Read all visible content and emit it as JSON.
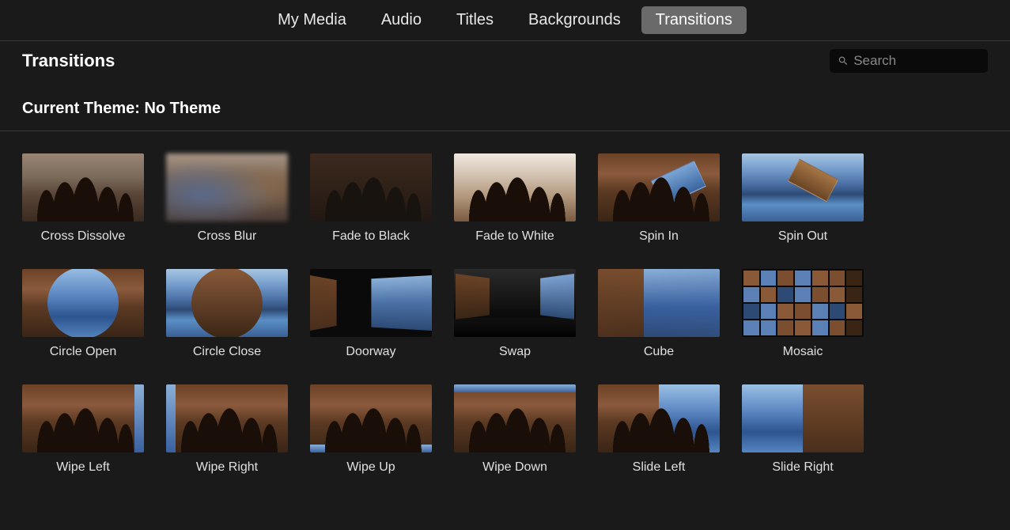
{
  "tabs": {
    "my_media": "My Media",
    "audio": "Audio",
    "titles": "Titles",
    "backgrounds": "Backgrounds",
    "transitions": "Transitions",
    "active": "transitions"
  },
  "section_title": "Transitions",
  "search": {
    "placeholder": "Search",
    "value": ""
  },
  "theme_label": "Current Theme: No Theme",
  "transitions": [
    {
      "id": "cross-dissolve",
      "label": "Cross Dissolve"
    },
    {
      "id": "cross-blur",
      "label": "Cross Blur"
    },
    {
      "id": "fade-to-black",
      "label": "Fade to Black"
    },
    {
      "id": "fade-to-white",
      "label": "Fade to White"
    },
    {
      "id": "spin-in",
      "label": "Spin In"
    },
    {
      "id": "spin-out",
      "label": "Spin Out"
    },
    {
      "id": "circle-open",
      "label": "Circle Open"
    },
    {
      "id": "circle-close",
      "label": "Circle Close"
    },
    {
      "id": "doorway",
      "label": "Doorway"
    },
    {
      "id": "swap",
      "label": "Swap"
    },
    {
      "id": "cube",
      "label": "Cube"
    },
    {
      "id": "mosaic",
      "label": "Mosaic"
    },
    {
      "id": "wipe-left",
      "label": "Wipe Left"
    },
    {
      "id": "wipe-right",
      "label": "Wipe Right"
    },
    {
      "id": "wipe-up",
      "label": "Wipe Up"
    },
    {
      "id": "wipe-down",
      "label": "Wipe Down"
    },
    {
      "id": "slide-left",
      "label": "Slide Left"
    },
    {
      "id": "slide-right",
      "label": "Slide Right"
    }
  ]
}
